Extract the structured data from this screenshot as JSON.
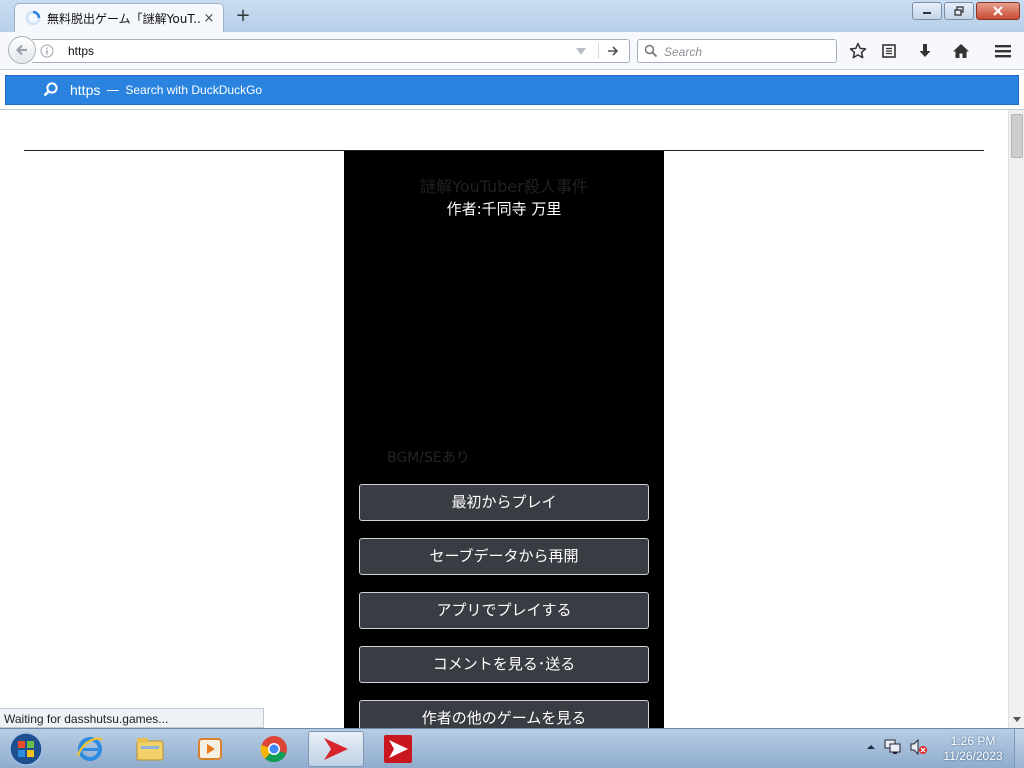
{
  "tab": {
    "title": "無料脱出ゲーム「謎解YouT...",
    "close": "×"
  },
  "new_tab": "+",
  "urlbar": {
    "text": "https"
  },
  "searchbar": {
    "placeholder": "Search"
  },
  "autocomplete": {
    "term": "https",
    "separator": "—",
    "action": "Search with DuckDuckGo"
  },
  "game": {
    "title": "謎解YouTuber殺人事件",
    "author": "作者:千同寺 万里",
    "bgm_note": "BGM/SEあり",
    "buttons": [
      "最初からプレイ",
      "セーブデータから再開",
      "アプリでプレイする",
      "コメントを見る･送る",
      "作者の他のゲームを見る"
    ]
  },
  "status": "Waiting for dasshutsu.games...",
  "clock": {
    "time": "1:26 PM",
    "date": "11/26/2023"
  },
  "colors": {
    "accent": "#2a84df",
    "panel": "#000000",
    "button": "#393c42"
  },
  "icons": [
    "back-arrow-icon",
    "info-icon",
    "dropmarker-icon",
    "go-arrow-icon",
    "search-icon",
    "star-icon",
    "reader-icon",
    "download-icon",
    "home-icon",
    "menu-icon",
    "start-orb-icon",
    "ie-icon",
    "explorer-icon",
    "media-player-icon",
    "chrome-icon",
    "pdf-app-icon",
    "network-icon",
    "volume-muted-icon",
    "tray-expand-icon"
  ]
}
